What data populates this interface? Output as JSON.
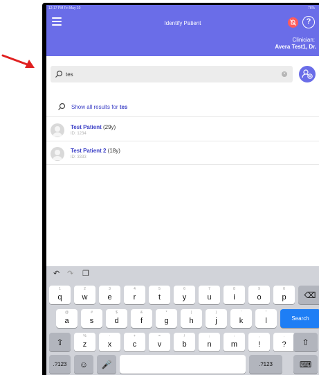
{
  "statusbar": {
    "time": "12:17 PM  Fri May 10",
    "battery": "76%"
  },
  "header": {
    "title": "Identify Patient",
    "help_label": "?",
    "clinician_label": "Clinician:",
    "clinician_name": "Avera Test1, Dr."
  },
  "search": {
    "value": "tes",
    "placeholder": ""
  },
  "show_all": {
    "prefix": "Show all results for ",
    "term": "tes"
  },
  "patients": [
    {
      "match": "Test",
      "name_rest": " Patient",
      "age": " (29y)",
      "id": "ID: 1234"
    },
    {
      "match": "Test",
      "name_rest": " Patient 2",
      "age": " (18y)",
      "id": "ID: 3333"
    }
  ],
  "keyboard": {
    "toolbar": {
      "undo": "↶",
      "redo": "↷",
      "paste": "❐"
    },
    "row1": [
      {
        "k": "q",
        "a": "1"
      },
      {
        "k": "w",
        "a": "2"
      },
      {
        "k": "e",
        "a": "3"
      },
      {
        "k": "r",
        "a": "4"
      },
      {
        "k": "t",
        "a": "5"
      },
      {
        "k": "y",
        "a": "6"
      },
      {
        "k": "u",
        "a": "7"
      },
      {
        "k": "i",
        "a": "8"
      },
      {
        "k": "o",
        "a": "9"
      },
      {
        "k": "p",
        "a": "0"
      }
    ],
    "row2": [
      {
        "k": "a",
        "a": "@"
      },
      {
        "k": "s",
        "a": "#"
      },
      {
        "k": "d",
        "a": "$"
      },
      {
        "k": "f",
        "a": "&"
      },
      {
        "k": "g",
        "a": "*"
      },
      {
        "k": "h",
        "a": "("
      },
      {
        "k": "j",
        "a": ")"
      },
      {
        "k": "k",
        "a": "'"
      },
      {
        "k": "l",
        "a": "\""
      }
    ],
    "row3": [
      {
        "k": "z",
        "a": "%"
      },
      {
        "k": "x",
        "a": "-"
      },
      {
        "k": "c",
        "a": "+"
      },
      {
        "k": "v",
        "a": "="
      },
      {
        "k": "b",
        "a": "/"
      },
      {
        "k": "n",
        "a": ";"
      },
      {
        "k": "m",
        "a": ":"
      },
      {
        "k": "!",
        "a": ","
      },
      {
        "k": "?",
        "a": "."
      }
    ],
    "backspace": "⌫",
    "search_label": "Search",
    "shift": "⇧",
    "numbers_label": ".?123",
    "emoji": "☺",
    "mic": "🎤",
    "hide": "⌨"
  },
  "colors": {
    "header": "#6a6de8",
    "accent": "#3c40c6",
    "search_key": "#1e7ef5",
    "alert": "#ff5b5b"
  }
}
